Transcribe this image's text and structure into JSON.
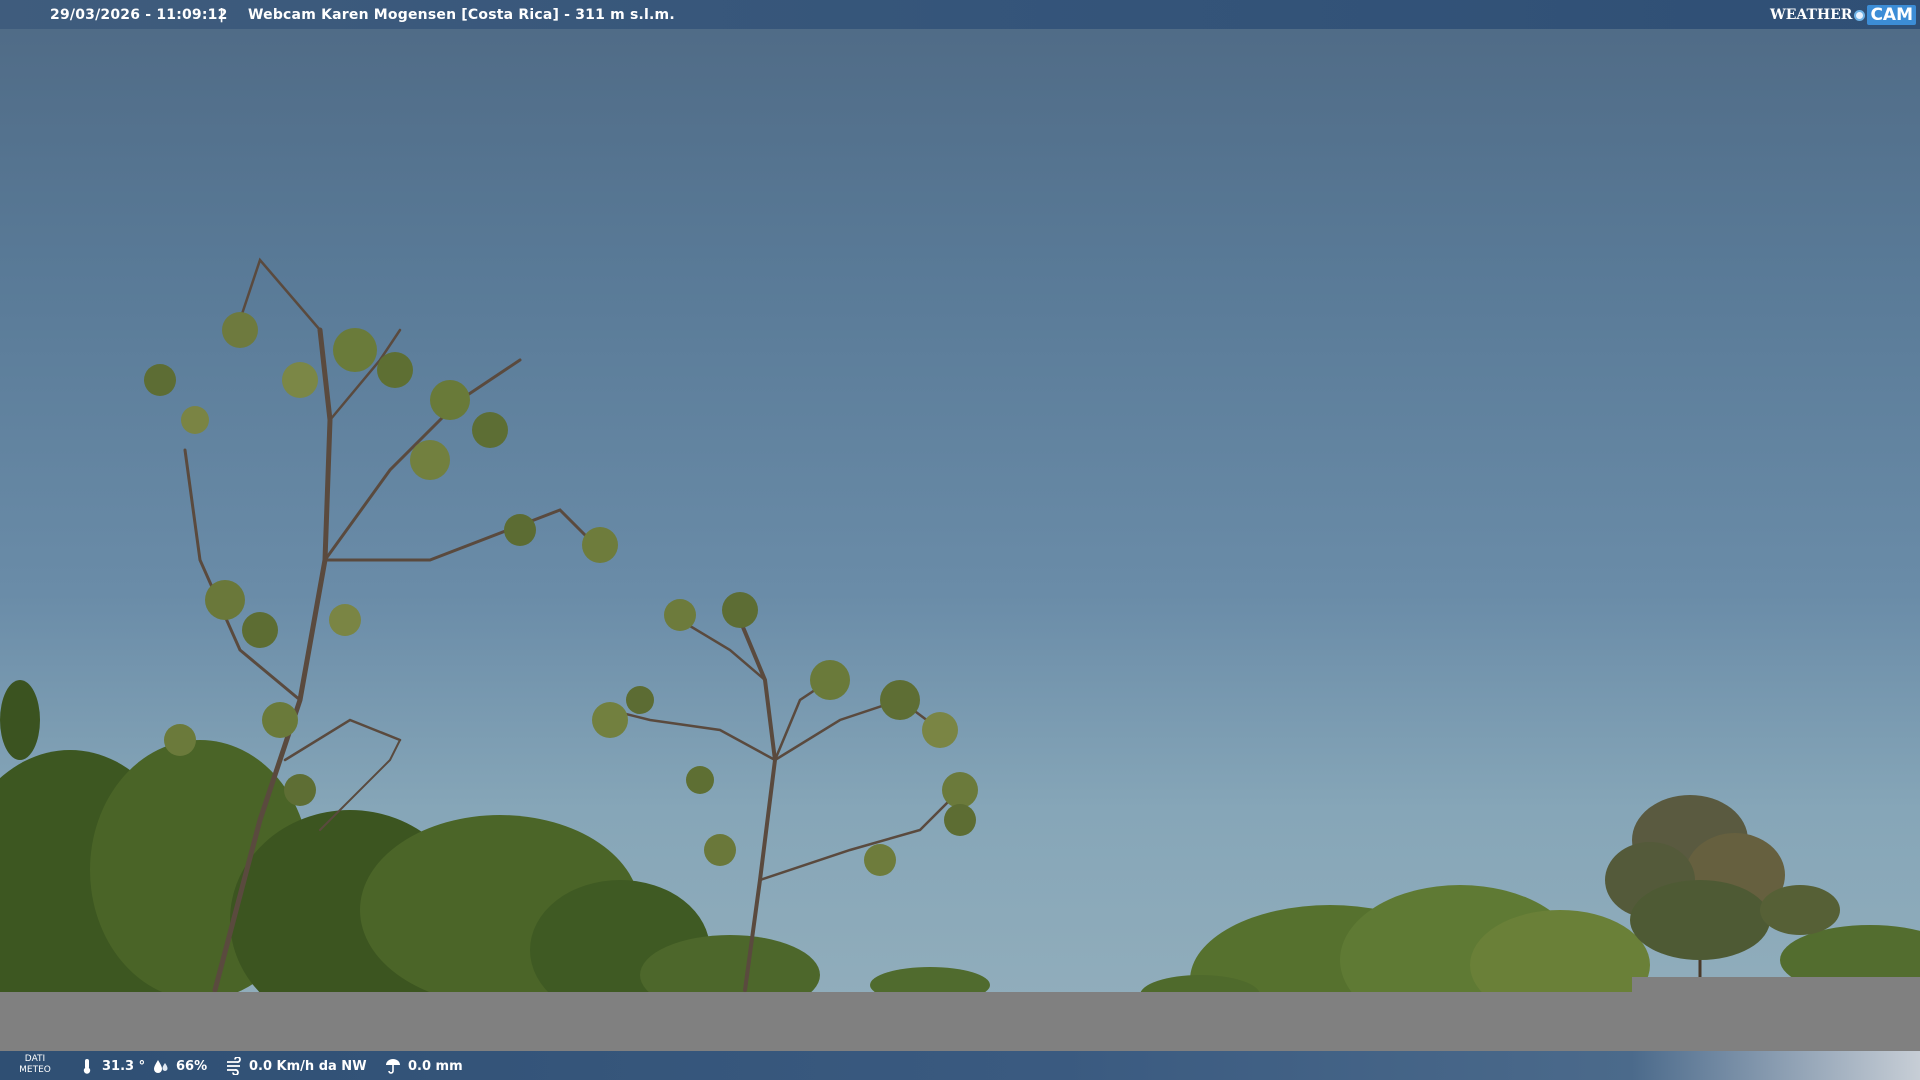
{
  "header": {
    "datetime": "29/03/2026 - 11:09:12",
    "separator": "|",
    "title": "Webcam Karen Mogensen [Costa Rica]  - 311 m s.l.m."
  },
  "logo": {
    "brand_word": "WEATHER",
    "brand_cam": "CAM",
    "icon": "weathercam-logo"
  },
  "footer": {
    "label_line1": "DATI",
    "label_line2": "METEO",
    "temperature": "31.3 °",
    "humidity": "66%",
    "wind": "0.0 Km/h da NW",
    "rain": "0.0 mm",
    "icons": [
      "thermometer-icon",
      "humidity-icon",
      "wind-icon",
      "rain-icon"
    ]
  },
  "colors": {
    "sky_top": "#4f6a85",
    "sky_horizon": "#95b0bd",
    "bar_blue": "#35557a",
    "occlusion_gray": "#808080",
    "foliage": "#3f5a22"
  }
}
